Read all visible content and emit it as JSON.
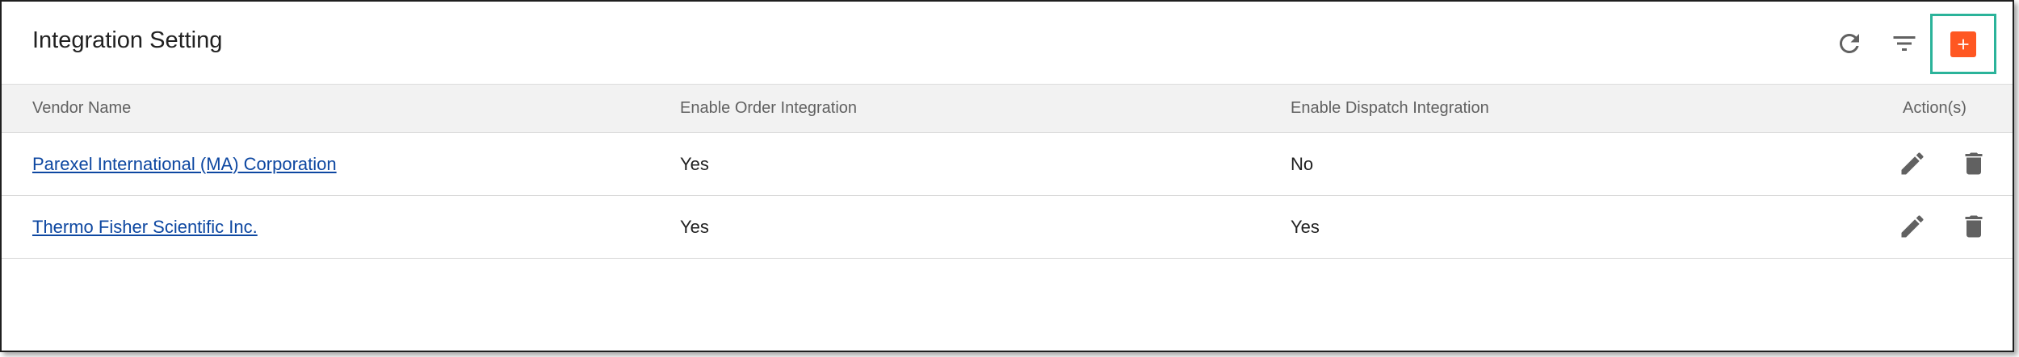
{
  "header": {
    "title": "Integration Setting",
    "toolbar": {
      "refresh_icon": "refresh-icon",
      "filter_icon": "filter-icon",
      "add_icon": "add-box-icon",
      "add_color": "#ff5722",
      "highlight_color": "#2bb39a"
    }
  },
  "table": {
    "columns": [
      "Vendor Name",
      "Enable Order Integration",
      "Enable Dispatch Integration",
      "Action(s)"
    ],
    "rows": [
      {
        "vendor": "Parexel International (MA) Corporation",
        "order": "Yes",
        "dispatch": "No"
      },
      {
        "vendor": "Thermo Fisher Scientific Inc.",
        "order": "Yes",
        "dispatch": "Yes"
      }
    ],
    "row_actions": [
      "edit-icon",
      "delete-icon"
    ]
  },
  "colors": {
    "link": "#0d47a1",
    "header_bg": "#f2f2f2",
    "icon": "#616161"
  }
}
